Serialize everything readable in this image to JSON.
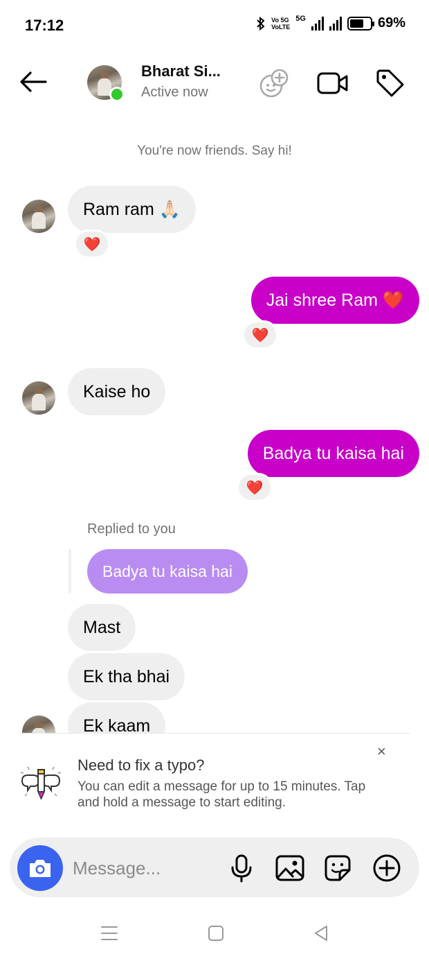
{
  "status_bar": {
    "time": "17:12",
    "network_top": "Vo 5G",
    "network_bottom": "VoLTE",
    "network_5g": "5G",
    "battery": "69%",
    "battery_level": 0.69
  },
  "header": {
    "name": "Bharat Si...",
    "status": "Active now"
  },
  "conversation": {
    "notice": "You're now friends. Say hi!",
    "msg1": "Ram ram 🙏🏻",
    "msg2": "Jai shree Ram ❤️",
    "msg3": "Kaise ho",
    "msg4": "Badya tu kaisa hai",
    "replied_label": "Replied to you",
    "quoted": "Badya tu kaisa hai",
    "msg5": "Mast",
    "msg6": "Ek tha bhai",
    "msg7": "Ek kaam",
    "reaction": "❤️"
  },
  "tip": {
    "title": "Need to fix a typo?",
    "text": "You can edit a message for up to 15 minutes. Tap and hold a message to start editing.",
    "close": "×"
  },
  "composer": {
    "placeholder": "Message..."
  },
  "colors": {
    "outgoing": "#c800c8",
    "incoming": "#efefef",
    "quoted": "#b98cf2",
    "camera": "#3a63f0",
    "online": "#31c92b"
  },
  "icons": {
    "back": "arrow-left",
    "add_people": "add-people-icon",
    "video": "video-camera-icon",
    "tag": "tag-icon",
    "camera": "camera-icon",
    "mic": "mic-icon",
    "gallery": "gallery-icon",
    "sticker": "sticker-icon",
    "plus": "plus-circle-icon"
  }
}
